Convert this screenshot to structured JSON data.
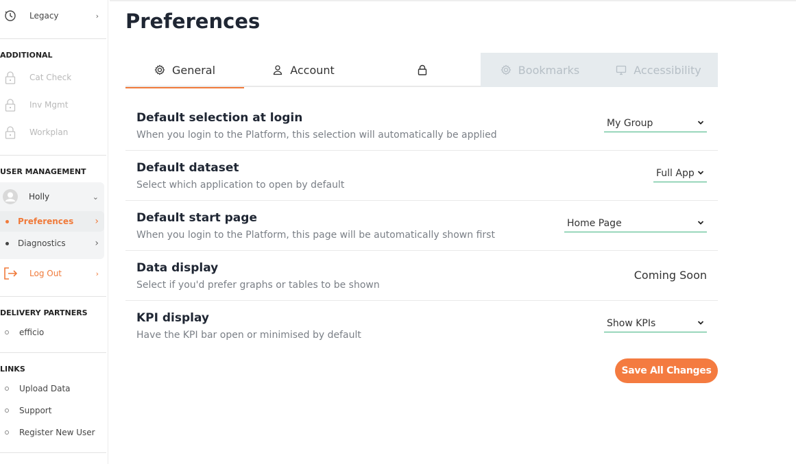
{
  "sidebar": {
    "legacy": {
      "label": "Legacy",
      "icon": "legacy-clock-icon"
    },
    "additional": {
      "heading": "ADDITIONAL",
      "items": [
        {
          "label": "Cat Check",
          "icon": "lock-icon"
        },
        {
          "label": "Inv Mgmt",
          "icon": "lock-icon"
        },
        {
          "label": "Workplan",
          "icon": "lock-icon"
        }
      ]
    },
    "user_management": {
      "heading": "USER MANAGEMENT",
      "user": {
        "name": "Holly",
        "icon": "avatar-icon"
      },
      "items": [
        {
          "label": "Preferences",
          "active": true
        },
        {
          "label": "Diagnostics",
          "active": false
        }
      ],
      "logout": {
        "label": "Log Out",
        "icon": "logout-icon"
      }
    },
    "delivery_partners": {
      "heading": "DELIVERY PARTNERS",
      "items": [
        {
          "label": "efficio"
        }
      ]
    },
    "links": {
      "heading": "LINKS",
      "items": [
        {
          "label": "Upload Data"
        },
        {
          "label": "Support"
        },
        {
          "label": "Register New User"
        }
      ]
    }
  },
  "page": {
    "title": "Preferences"
  },
  "tabs": [
    {
      "label": "General",
      "icon": "gear-icon",
      "active": true,
      "disabled": false
    },
    {
      "label": "Account",
      "icon": "user-icon",
      "active": false,
      "disabled": false
    },
    {
      "label": "",
      "icon": "lock-icon",
      "active": false,
      "disabled": false
    },
    {
      "label": "Bookmarks",
      "icon": "gear-icon",
      "active": false,
      "disabled": true
    },
    {
      "label": "Accessibility",
      "icon": "monitor-icon",
      "active": false,
      "disabled": true
    }
  ],
  "settings": [
    {
      "title": "Default selection at login",
      "description": "When you login to the Platform, this selection will automatically be applied",
      "control": "select",
      "value": "My Group"
    },
    {
      "title": "Default dataset",
      "description": "Select which application to open by default",
      "control": "select",
      "value": "Full App"
    },
    {
      "title": "Default start page",
      "description": "When you login to the Platform, this page will be automatically shown first",
      "control": "select",
      "value": "Home Page"
    },
    {
      "title": "Data display",
      "description": "Select if you'd prefer graphs or tables to be shown",
      "control": "text",
      "value": "Coming Soon"
    },
    {
      "title": "KPI display",
      "description": "Have the KPI bar open or minimised by default",
      "control": "select",
      "value": "Show KPIs"
    }
  ],
  "actions": {
    "save_label": "Save All Changes"
  },
  "colors": {
    "accent": "#f47b40",
    "underline": "#3fb37f",
    "disabled_tab_bg": "#e6ebee"
  }
}
